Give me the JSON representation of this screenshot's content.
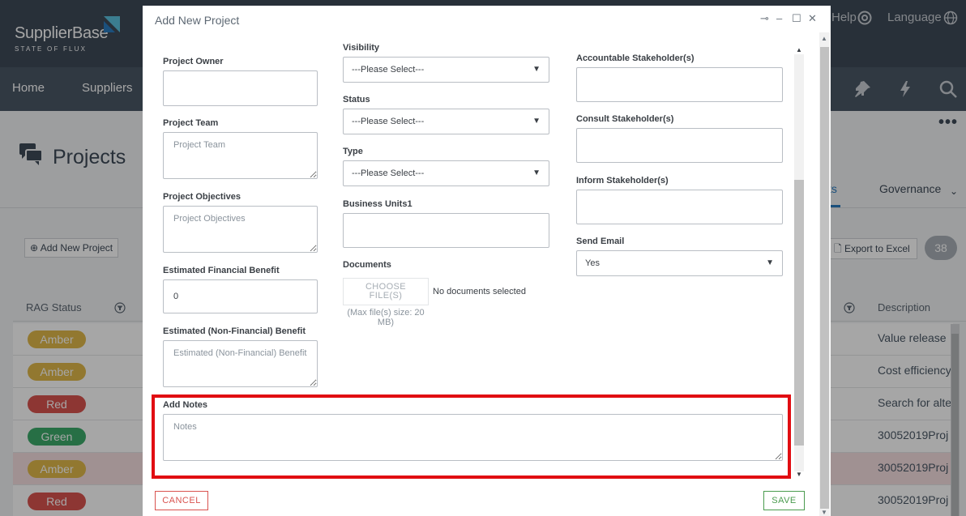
{
  "app": {
    "logo_text": "SupplierBase",
    "logo_subtext": "STATE OF FLUX",
    "header_right": {
      "help": "Help",
      "language": "Language"
    },
    "nav": [
      "Home",
      "Suppliers"
    ],
    "page_title": "Projects",
    "tabs": {
      "active": "ts",
      "governance": "Governance"
    },
    "add_project_button": "Add New Project",
    "export_button": "Export to Excel",
    "count": "38",
    "table": {
      "headers": {
        "rag": "RAG Status",
        "description": "Description"
      },
      "rows": [
        {
          "rag": "Amber",
          "color": "#e0b84a",
          "description": "Value release",
          "selected": false
        },
        {
          "rag": "Amber",
          "color": "#e0b84a",
          "description": "Cost efficiency",
          "selected": false
        },
        {
          "rag": "Red",
          "color": "#d9534f",
          "description": "Search for alte",
          "selected": false
        },
        {
          "rag": "Green",
          "color": "#3cab6a",
          "description": "30052019Proj",
          "selected": false
        },
        {
          "rag": "Amber",
          "color": "#e0b84a",
          "description": "30052019Proj",
          "selected": true
        },
        {
          "rag": "Red",
          "color": "#d9534f",
          "description": "30052019Proj",
          "selected": false
        }
      ]
    }
  },
  "modal": {
    "title": "Add New Project",
    "controls": {
      "pin": "⊸",
      "minimize": "–",
      "maximize": "☐",
      "close": "✕"
    },
    "left": {
      "project_owner": {
        "label": "Project Owner",
        "value": ""
      },
      "project_team": {
        "label": "Project Team",
        "placeholder": "Project Team"
      },
      "project_objectives": {
        "label": "Project Objectives",
        "placeholder": "Project Objectives"
      },
      "estimated_financial_benefit": {
        "label": "Estimated Financial Benefit",
        "value": "0"
      },
      "estimated_non_financial_benefit": {
        "label": "Estimated (Non-Financial) Benefit",
        "placeholder": "Estimated (Non-Financial) Benefit"
      }
    },
    "middle": {
      "visibility": {
        "label": "Visibility",
        "value": "---Please Select---"
      },
      "status": {
        "label": "Status",
        "value": "---Please Select---"
      },
      "type": {
        "label": "Type",
        "value": "---Please Select---"
      },
      "business_units": {
        "label": "Business Units1",
        "value": ""
      },
      "documents": {
        "label": "Documents",
        "choose_file_line1": "CHOOSE",
        "choose_file_line2": "FILE(S)",
        "no_docs": "No documents selected",
        "max_size": "(Max file(s) size: 20 MB)"
      }
    },
    "right": {
      "accountable": {
        "label": "Accountable Stakeholder(s)"
      },
      "consult": {
        "label": "Consult Stakeholder(s)"
      },
      "inform": {
        "label": "Inform Stakeholder(s)"
      },
      "send_email": {
        "label": "Send Email",
        "value": "Yes"
      }
    },
    "notes": {
      "label": "Add Notes",
      "placeholder": "Notes"
    },
    "cancel_label": "CANCEL",
    "save_label": "SAVE",
    "highlight_color": "#e10d12"
  }
}
